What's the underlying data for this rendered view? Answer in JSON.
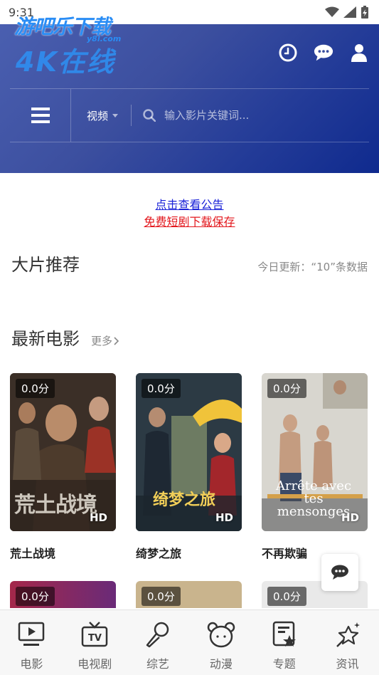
{
  "status_bar": {
    "time": "9:31"
  },
  "header": {
    "logo": {
      "line1": "游吧乐下载",
      "sub": "y8l.com",
      "line2": "4K在线"
    },
    "category": "视频",
    "search_placeholder": "输入影片关键词..."
  },
  "notices": {
    "announcement_link": "点击查看公告",
    "download_link": "免费短剧下载保存"
  },
  "featured": {
    "title": "大片推荐",
    "update_info": "今日更新：“10”条数据"
  },
  "latest_movies": {
    "title": "最新电影",
    "more_label": "更多",
    "items": [
      {
        "title": "荒土战境",
        "score": "0.0分",
        "quality": "HD",
        "poster_text": "荒土战境"
      },
      {
        "title": "绮梦之旅",
        "score": "0.0分",
        "quality": "HD",
        "poster_text": "绮梦之旅"
      },
      {
        "title": "不再欺骗",
        "score": "0.0分",
        "quality": "HD",
        "poster_text": "Arrête avec tes mensonges"
      },
      {
        "title": "",
        "score": "0.0分"
      },
      {
        "title": "",
        "score": "0.0分"
      },
      {
        "title": "",
        "score": "0.0分"
      }
    ]
  },
  "bottom_nav": [
    {
      "label": "电影",
      "icon": "movie-screen-icon"
    },
    {
      "label": "电视剧",
      "icon": "tv-icon"
    },
    {
      "label": "综艺",
      "icon": "microphone-icon"
    },
    {
      "label": "动漫",
      "icon": "bear-icon"
    },
    {
      "label": "专题",
      "icon": "star-document-icon"
    },
    {
      "label": "资讯",
      "icon": "sparkle-icon"
    }
  ],
  "colors": {
    "header_gradient_start": "#4a5fb0",
    "header_gradient_end": "#0f2a8e",
    "link_blue": "#1a22d8",
    "link_red": "#e3171d"
  }
}
